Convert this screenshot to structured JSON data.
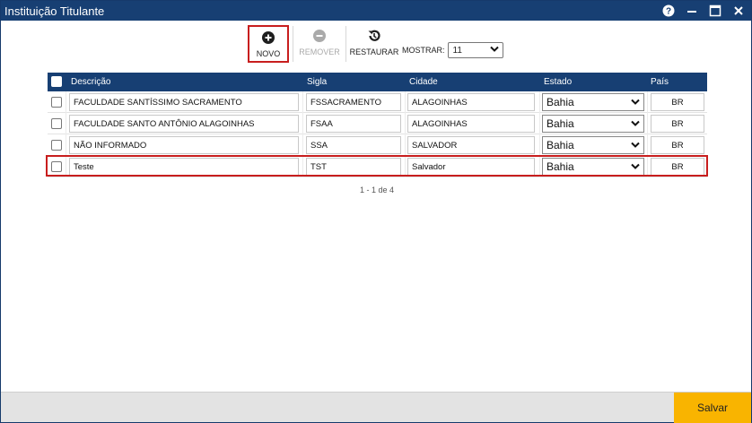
{
  "window": {
    "title": "Instituição Titulante",
    "controls": [
      "help-icon",
      "minimize-icon",
      "maximize-icon",
      "close-icon"
    ]
  },
  "toolbar": {
    "novo_label": "NOVO",
    "remover_label": "REMOVER",
    "restaurar_label": "RESTAURAR",
    "mostrar_label": "MOSTRAR:",
    "mostrar_value": "11"
  },
  "grid": {
    "headers": {
      "descricao": "Descrição",
      "sigla": "Sigla",
      "cidade": "Cidade",
      "estado": "Estado",
      "pais": "País"
    },
    "rows": [
      {
        "descricao": "FACULDADE SANTÍSSIMO SACRAMENTO",
        "sigla": "FSSACRAMENTO",
        "cidade": "ALAGOINHAS",
        "estado": "Bahia",
        "pais": "BR"
      },
      {
        "descricao": "FACULDADE SANTO ANTÔNIO ALAGOINHAS",
        "sigla": "FSAA",
        "cidade": "ALAGOINHAS",
        "estado": "Bahia",
        "pais": "BR"
      },
      {
        "descricao": "NÃO INFORMADO",
        "sigla": "SSA",
        "cidade": "SALVADOR",
        "estado": "Bahia",
        "pais": "BR"
      },
      {
        "descricao": "Teste",
        "sigla": "TST",
        "cidade": "Salvador",
        "estado": "Bahia",
        "pais": "BR"
      }
    ]
  },
  "pager": {
    "text": "1 - 1 de 4"
  },
  "footer": {
    "save_label": "Salvar"
  },
  "colors": {
    "titlebar": "#173f73",
    "highlight": "#c81e1e",
    "save": "#f9b400"
  }
}
